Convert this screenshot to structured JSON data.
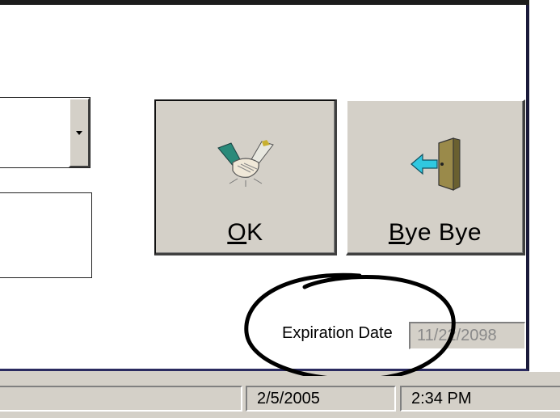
{
  "buttons": {
    "ok": {
      "mnemonic": "O",
      "rest": "K"
    },
    "bye": {
      "mnemonic": "B",
      "rest": "ye Bye"
    }
  },
  "expiration": {
    "label": "Expiration Date",
    "value": "11/22/2098"
  },
  "statusbar": {
    "date": "2/5/2005",
    "time": "2:34 PM"
  },
  "icons": {
    "ok": "handshake-icon",
    "bye": "exit-door-icon"
  }
}
